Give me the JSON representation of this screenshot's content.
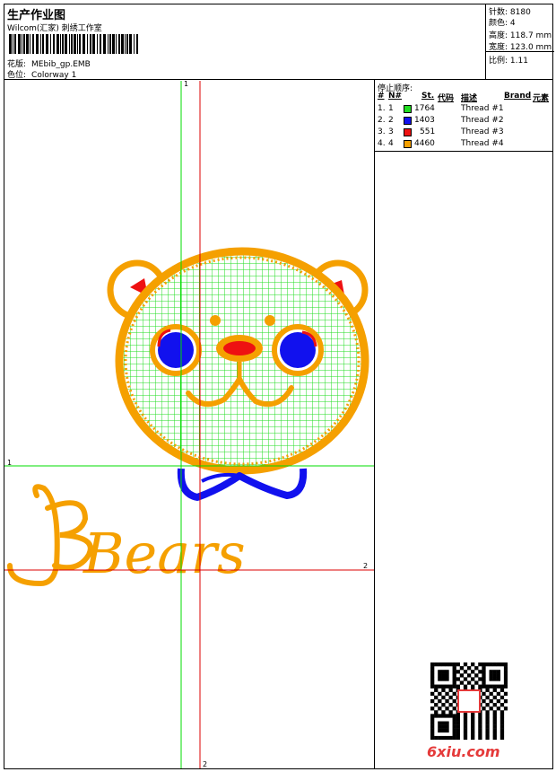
{
  "header": {
    "title": "生产作业图",
    "studio": "Wilcom(汇家) 刺绣工作室",
    "design_label": "花版:",
    "design_value": "MEbib_gp.EMB",
    "colorway_label": "色位:",
    "colorway_value": "Colorway 1"
  },
  "stats": [
    {
      "label": "针数:",
      "value": "8180"
    },
    {
      "label": "颜色:",
      "value": "4"
    },
    {
      "label": "高度:",
      "value": "118.7 mm"
    },
    {
      "label": "宽度:",
      "value": "123.0 mm"
    },
    {
      "label": "比例:",
      "value": "1.11"
    }
  ],
  "stop_order": {
    "title": "停止顺序:",
    "headers": [
      "#",
      "N#",
      "St.",
      "代码",
      "描述",
      "Brand",
      "元素"
    ],
    "rows": [
      {
        "n": "1.",
        "nn": "1",
        "color": "#22dd22",
        "st": "1764",
        "desc": "Thread #1"
      },
      {
        "n": "2.",
        "nn": "2",
        "color": "#1111ee",
        "st": "1403",
        "desc": "Thread #2"
      },
      {
        "n": "3.",
        "nn": "3",
        "color": "#ee1111",
        "st": "551",
        "desc": "Thread #3"
      },
      {
        "n": "4.",
        "nn": "4",
        "color": "#f5a000",
        "st": "4460",
        "desc": "Thread #4"
      }
    ]
  },
  "guides": {
    "v1": "1",
    "v2": "2",
    "h1": "1",
    "h2": "2"
  },
  "design": {
    "text": "Bears"
  },
  "colors": {
    "green_guide": "#00dd00",
    "red_guide": "#dd0000",
    "orange": "#f5a000",
    "green": "#22dd22",
    "blue": "#1111ee",
    "red": "#ee1111"
  },
  "watermark": "6xiu.com"
}
